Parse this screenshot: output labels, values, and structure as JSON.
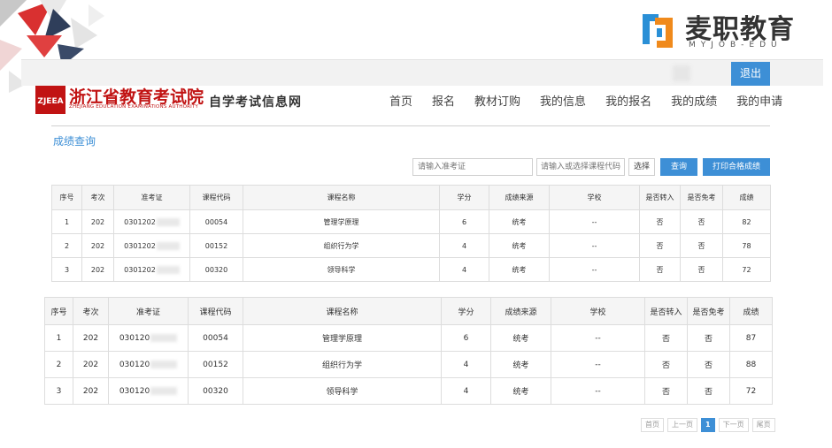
{
  "brand": {
    "name": "麦职教育",
    "sub": "MYJOB-EDU"
  },
  "topbar": {
    "logout_label": "退出"
  },
  "header": {
    "logo_text": "ZJEEA",
    "title": "浙江省教育考试院",
    "subtitle_en": "ZHEJIANG EDUCATION EXAMINATIONS AUTHORITY",
    "system_name": "自学考试信息网"
  },
  "nav": [
    "首页",
    "报名",
    "教材订购",
    "我的信息",
    "我的报名",
    "我的成绩",
    "我的申请"
  ],
  "page_title": "成绩查询",
  "search": {
    "ticket_placeholder": "请输入准考证",
    "course_placeholder": "请输入或选择课程代码",
    "select_label": "选择",
    "query_label": "查询",
    "print_label": "打印合格成绩"
  },
  "columns": [
    "序号",
    "考次",
    "准考证",
    "课程代码",
    "课程名称",
    "学分",
    "成绩来源",
    "学校",
    "是否转入",
    "是否免考",
    "成绩"
  ],
  "table1": [
    [
      "1",
      "202",
      "0301202",
      "00054",
      "管理学原理",
      "6",
      "统考",
      "--",
      "否",
      "否",
      "82"
    ],
    [
      "2",
      "202",
      "0301202",
      "00152",
      "组织行为学",
      "4",
      "统考",
      "--",
      "否",
      "否",
      "78"
    ],
    [
      "3",
      "202",
      "0301202",
      "00320",
      "领导科学",
      "4",
      "统考",
      "--",
      "否",
      "否",
      "72"
    ]
  ],
  "table2": [
    [
      "1",
      "202",
      "030120",
      "00054",
      "管理学原理",
      "6",
      "统考",
      "--",
      "否",
      "否",
      "87"
    ],
    [
      "2",
      "202",
      "030120",
      "00152",
      "组织行为学",
      "4",
      "统考",
      "--",
      "否",
      "否",
      "88"
    ],
    [
      "3",
      "202",
      "030120",
      "00320",
      "领导科学",
      "4",
      "统考",
      "--",
      "否",
      "否",
      "72"
    ]
  ],
  "pagination": {
    "first": "首页",
    "prev": "上一页",
    "current": "1",
    "next": "下一页",
    "last": "尾页"
  },
  "colors": {
    "accent": "#3d8fd6",
    "title_red": "#c11313"
  }
}
